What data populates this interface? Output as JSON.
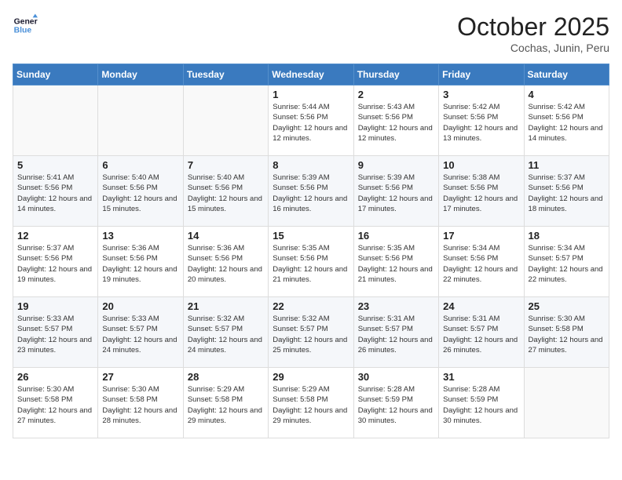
{
  "header": {
    "logo_line1": "General",
    "logo_line2": "Blue",
    "month": "October 2025",
    "location": "Cochas, Junin, Peru"
  },
  "weekdays": [
    "Sunday",
    "Monday",
    "Tuesday",
    "Wednesday",
    "Thursday",
    "Friday",
    "Saturday"
  ],
  "weeks": [
    [
      {
        "day": "",
        "sunrise": "",
        "sunset": "",
        "daylight": ""
      },
      {
        "day": "",
        "sunrise": "",
        "sunset": "",
        "daylight": ""
      },
      {
        "day": "",
        "sunrise": "",
        "sunset": "",
        "daylight": ""
      },
      {
        "day": "1",
        "sunrise": "Sunrise: 5:44 AM",
        "sunset": "Sunset: 5:56 PM",
        "daylight": "Daylight: 12 hours and 12 minutes."
      },
      {
        "day": "2",
        "sunrise": "Sunrise: 5:43 AM",
        "sunset": "Sunset: 5:56 PM",
        "daylight": "Daylight: 12 hours and 12 minutes."
      },
      {
        "day": "3",
        "sunrise": "Sunrise: 5:42 AM",
        "sunset": "Sunset: 5:56 PM",
        "daylight": "Daylight: 12 hours and 13 minutes."
      },
      {
        "day": "4",
        "sunrise": "Sunrise: 5:42 AM",
        "sunset": "Sunset: 5:56 PM",
        "daylight": "Daylight: 12 hours and 14 minutes."
      }
    ],
    [
      {
        "day": "5",
        "sunrise": "Sunrise: 5:41 AM",
        "sunset": "Sunset: 5:56 PM",
        "daylight": "Daylight: 12 hours and 14 minutes."
      },
      {
        "day": "6",
        "sunrise": "Sunrise: 5:40 AM",
        "sunset": "Sunset: 5:56 PM",
        "daylight": "Daylight: 12 hours and 15 minutes."
      },
      {
        "day": "7",
        "sunrise": "Sunrise: 5:40 AM",
        "sunset": "Sunset: 5:56 PM",
        "daylight": "Daylight: 12 hours and 15 minutes."
      },
      {
        "day": "8",
        "sunrise": "Sunrise: 5:39 AM",
        "sunset": "Sunset: 5:56 PM",
        "daylight": "Daylight: 12 hours and 16 minutes."
      },
      {
        "day": "9",
        "sunrise": "Sunrise: 5:39 AM",
        "sunset": "Sunset: 5:56 PM",
        "daylight": "Daylight: 12 hours and 17 minutes."
      },
      {
        "day": "10",
        "sunrise": "Sunrise: 5:38 AM",
        "sunset": "Sunset: 5:56 PM",
        "daylight": "Daylight: 12 hours and 17 minutes."
      },
      {
        "day": "11",
        "sunrise": "Sunrise: 5:37 AM",
        "sunset": "Sunset: 5:56 PM",
        "daylight": "Daylight: 12 hours and 18 minutes."
      }
    ],
    [
      {
        "day": "12",
        "sunrise": "Sunrise: 5:37 AM",
        "sunset": "Sunset: 5:56 PM",
        "daylight": "Daylight: 12 hours and 19 minutes."
      },
      {
        "day": "13",
        "sunrise": "Sunrise: 5:36 AM",
        "sunset": "Sunset: 5:56 PM",
        "daylight": "Daylight: 12 hours and 19 minutes."
      },
      {
        "day": "14",
        "sunrise": "Sunrise: 5:36 AM",
        "sunset": "Sunset: 5:56 PM",
        "daylight": "Daylight: 12 hours and 20 minutes."
      },
      {
        "day": "15",
        "sunrise": "Sunrise: 5:35 AM",
        "sunset": "Sunset: 5:56 PM",
        "daylight": "Daylight: 12 hours and 21 minutes."
      },
      {
        "day": "16",
        "sunrise": "Sunrise: 5:35 AM",
        "sunset": "Sunset: 5:56 PM",
        "daylight": "Daylight: 12 hours and 21 minutes."
      },
      {
        "day": "17",
        "sunrise": "Sunrise: 5:34 AM",
        "sunset": "Sunset: 5:56 PM",
        "daylight": "Daylight: 12 hours and 22 minutes."
      },
      {
        "day": "18",
        "sunrise": "Sunrise: 5:34 AM",
        "sunset": "Sunset: 5:57 PM",
        "daylight": "Daylight: 12 hours and 22 minutes."
      }
    ],
    [
      {
        "day": "19",
        "sunrise": "Sunrise: 5:33 AM",
        "sunset": "Sunset: 5:57 PM",
        "daylight": "Daylight: 12 hours and 23 minutes."
      },
      {
        "day": "20",
        "sunrise": "Sunrise: 5:33 AM",
        "sunset": "Sunset: 5:57 PM",
        "daylight": "Daylight: 12 hours and 24 minutes."
      },
      {
        "day": "21",
        "sunrise": "Sunrise: 5:32 AM",
        "sunset": "Sunset: 5:57 PM",
        "daylight": "Daylight: 12 hours and 24 minutes."
      },
      {
        "day": "22",
        "sunrise": "Sunrise: 5:32 AM",
        "sunset": "Sunset: 5:57 PM",
        "daylight": "Daylight: 12 hours and 25 minutes."
      },
      {
        "day": "23",
        "sunrise": "Sunrise: 5:31 AM",
        "sunset": "Sunset: 5:57 PM",
        "daylight": "Daylight: 12 hours and 26 minutes."
      },
      {
        "day": "24",
        "sunrise": "Sunrise: 5:31 AM",
        "sunset": "Sunset: 5:57 PM",
        "daylight": "Daylight: 12 hours and 26 minutes."
      },
      {
        "day": "25",
        "sunrise": "Sunrise: 5:30 AM",
        "sunset": "Sunset: 5:58 PM",
        "daylight": "Daylight: 12 hours and 27 minutes."
      }
    ],
    [
      {
        "day": "26",
        "sunrise": "Sunrise: 5:30 AM",
        "sunset": "Sunset: 5:58 PM",
        "daylight": "Daylight: 12 hours and 27 minutes."
      },
      {
        "day": "27",
        "sunrise": "Sunrise: 5:30 AM",
        "sunset": "Sunset: 5:58 PM",
        "daylight": "Daylight: 12 hours and 28 minutes."
      },
      {
        "day": "28",
        "sunrise": "Sunrise: 5:29 AM",
        "sunset": "Sunset: 5:58 PM",
        "daylight": "Daylight: 12 hours and 29 minutes."
      },
      {
        "day": "29",
        "sunrise": "Sunrise: 5:29 AM",
        "sunset": "Sunset: 5:58 PM",
        "daylight": "Daylight: 12 hours and 29 minutes."
      },
      {
        "day": "30",
        "sunrise": "Sunrise: 5:28 AM",
        "sunset": "Sunset: 5:59 PM",
        "daylight": "Daylight: 12 hours and 30 minutes."
      },
      {
        "day": "31",
        "sunrise": "Sunrise: 5:28 AM",
        "sunset": "Sunset: 5:59 PM",
        "daylight": "Daylight: 12 hours and 30 minutes."
      },
      {
        "day": "",
        "sunrise": "",
        "sunset": "",
        "daylight": ""
      }
    ]
  ]
}
